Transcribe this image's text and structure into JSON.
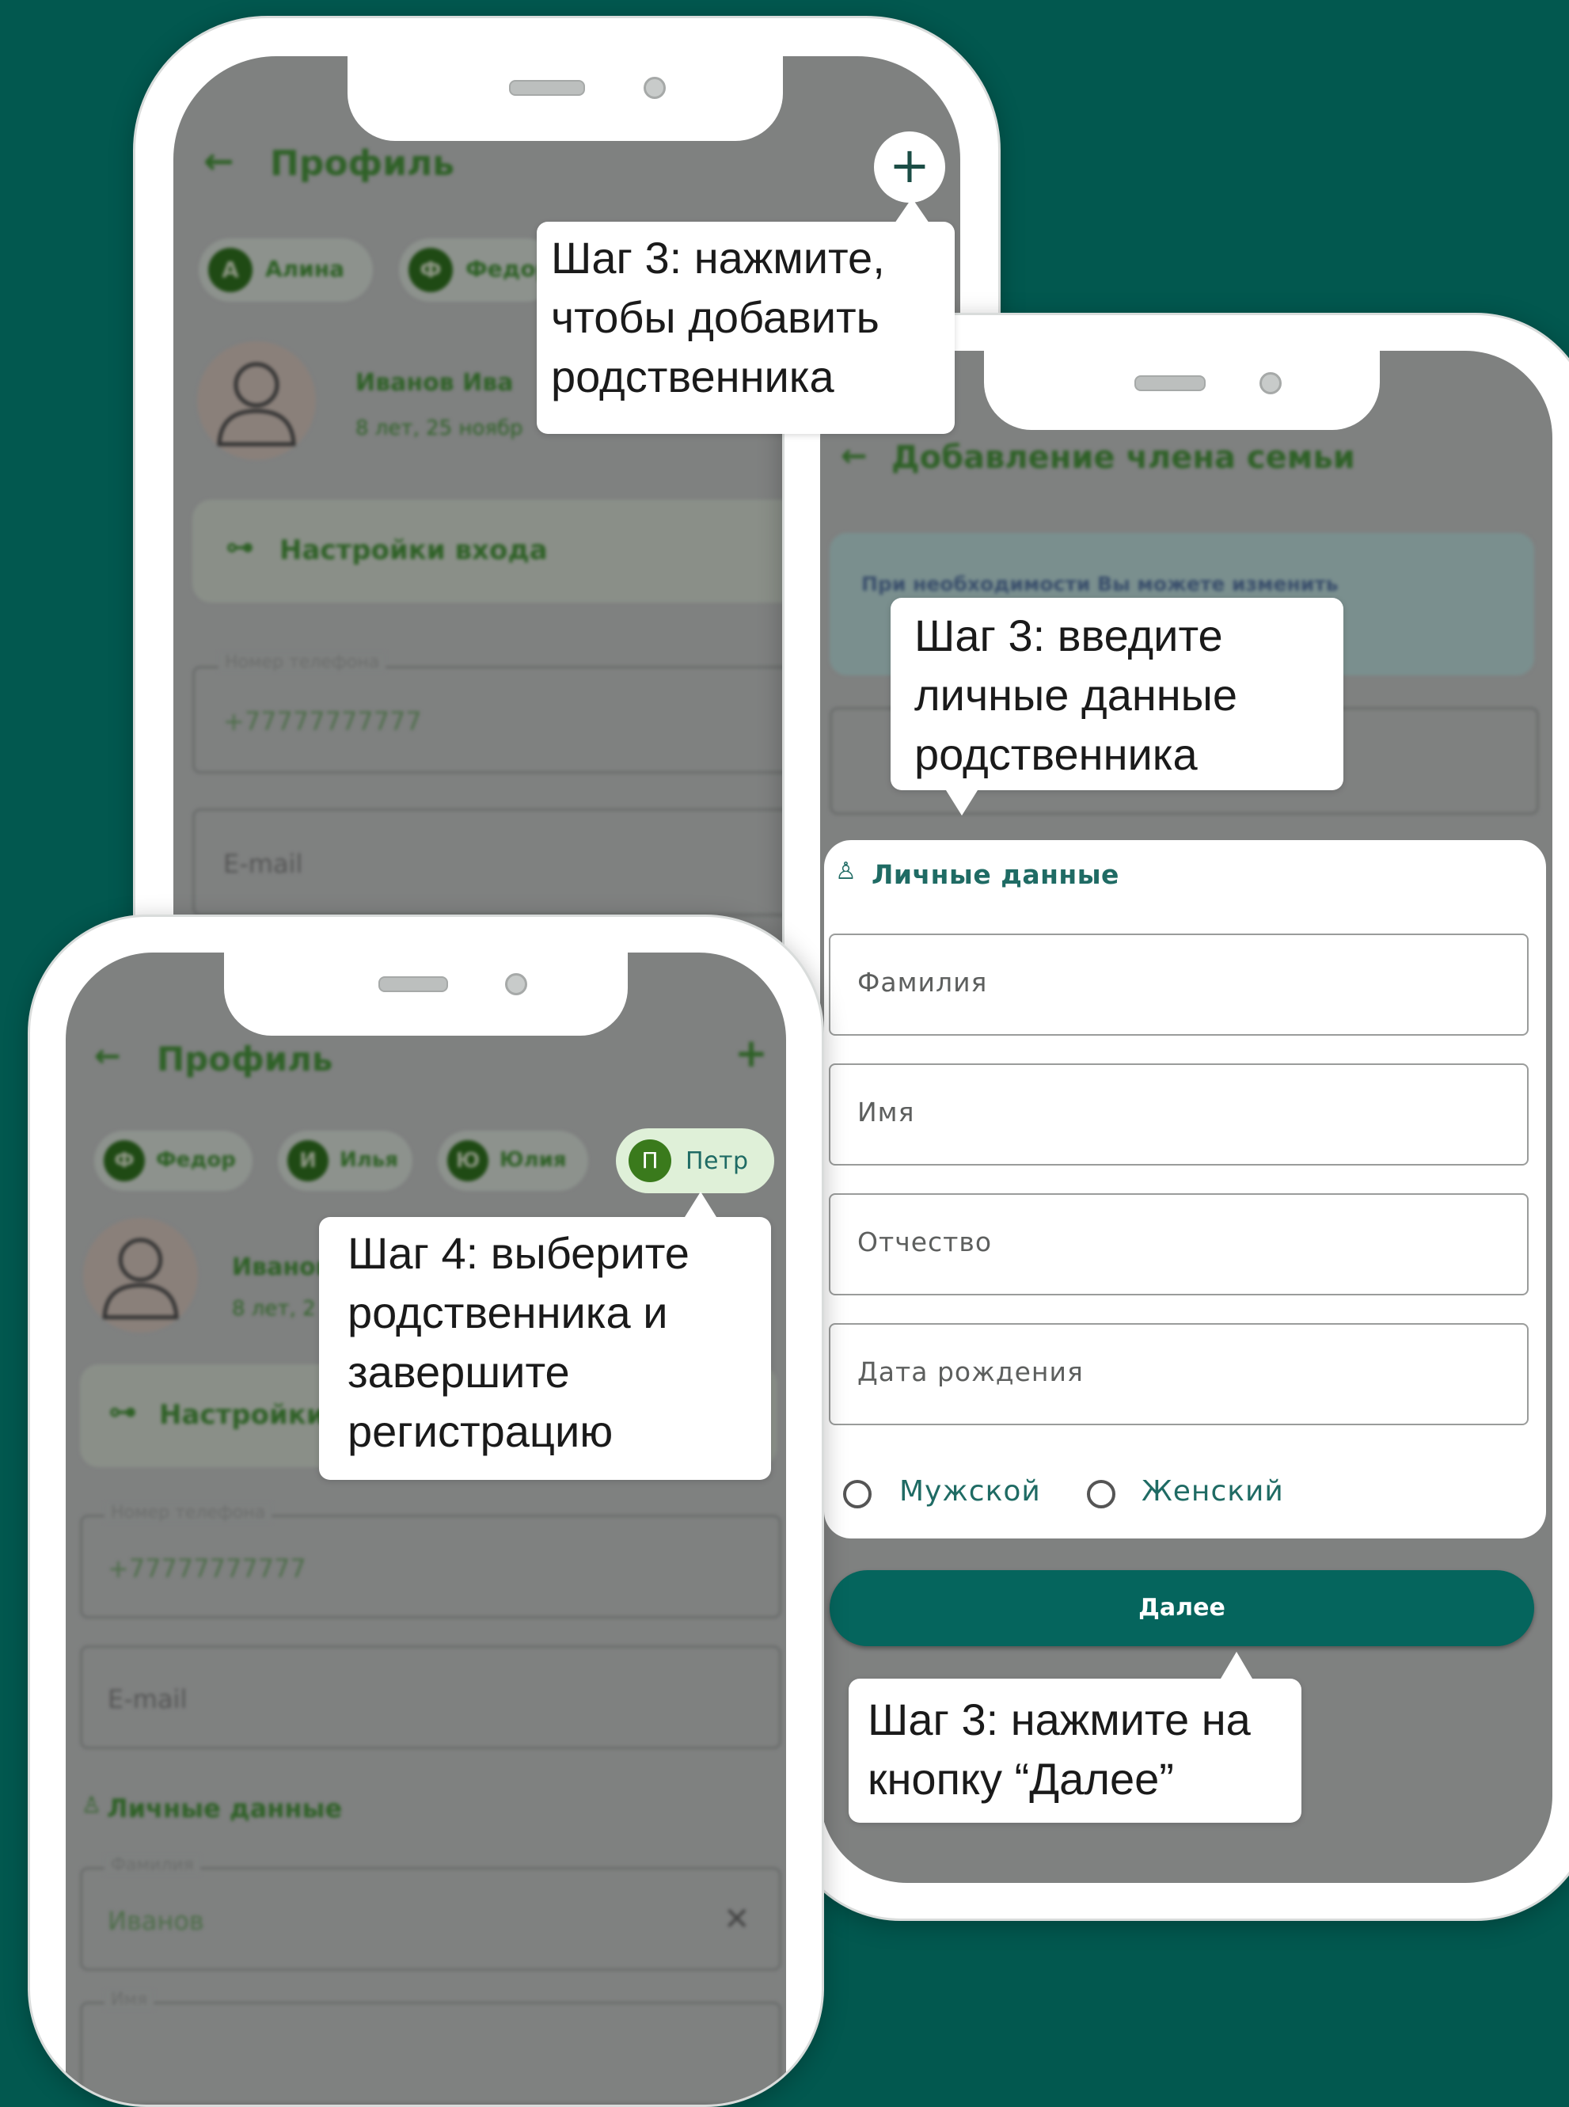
{
  "phone1": {
    "title": "Профиль",
    "plus": "+",
    "back": "←",
    "chips": [
      {
        "initial": "А",
        "name": "Алина"
      },
      {
        "initial": "Ф",
        "name": "Федор"
      }
    ],
    "user_name": "Иванов Ива",
    "user_age": "8 лет, 25 ноябр",
    "login_settings": "Настройки входа",
    "phone_label": "Номер телефона",
    "phone_value": "+77777777777",
    "email": "E-mail"
  },
  "phone2": {
    "back": "←",
    "title": "Добавление члена семьи",
    "info_text": "При необходимости Вы можете изменить",
    "section_title": "Личные данные",
    "fields": [
      "Фамилия",
      "Имя",
      "Отчество",
      "Дата рождения"
    ],
    "gender": [
      "Мужской",
      "Женский"
    ],
    "next_button": "Далее"
  },
  "phone3": {
    "back": "←",
    "title": "Профиль",
    "plus": "+",
    "chips": [
      {
        "initial": "Ф",
        "name": "Федор"
      },
      {
        "initial": "И",
        "name": "Илья"
      },
      {
        "initial": "Ю",
        "name": "Юлия"
      }
    ],
    "active_chip": {
      "initial": "П",
      "name": "Петр"
    },
    "user_name": "Иванов",
    "user_age": "8 лет, 2",
    "login_settings": "Настройки",
    "phone_label": "Номер телефона",
    "phone_value": "+77777777777",
    "email": "E-mail",
    "section_title": "Личные данные",
    "surname_label": "Фамилия",
    "surname_value": "Иванов",
    "name_label": "Имя",
    "clear_icon": "✕"
  },
  "tooltips": {
    "add_relative": [
      "Шаг 3: нажмите,",
      "чтобы добавить",
      "родственника"
    ],
    "enter_data": [
      "Шаг 3: введите",
      "личные данные",
      "родственника"
    ],
    "press_next": [
      "Шаг 3: нажмите на",
      "кнопку “Далее”"
    ],
    "choose_relative": [
      "Шаг 4: выберите",
      "родственника и",
      "завершите",
      "регистрацию"
    ]
  },
  "colors": {
    "background": "#02584f",
    "accent": "#05655d",
    "dim_screen": "#7f8180",
    "chip_active": "#dff0d8"
  }
}
